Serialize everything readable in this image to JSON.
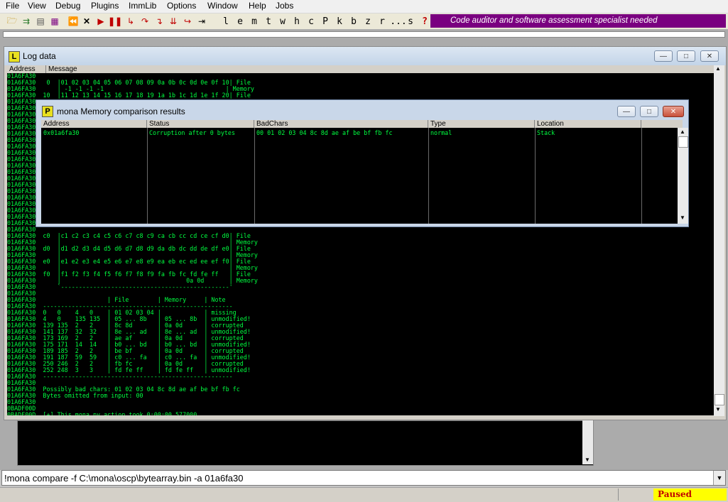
{
  "menu": [
    "File",
    "View",
    "Debug",
    "Plugins",
    "ImmLib",
    "Options",
    "Window",
    "Help",
    "Jobs"
  ],
  "toolbar": {
    "letters": [
      "l",
      "e",
      "m",
      "t",
      "w",
      "h",
      "c",
      "P",
      "k",
      "b",
      "z",
      "r",
      "...",
      "s",
      "?"
    ],
    "promo": "Code auditor and software assessment specialist needed"
  },
  "log_window": {
    "icon": "L",
    "title": "Log data",
    "col_address": "Address",
    "col_message": "Message",
    "lines": [
      "01A6FA30  ",
      "01A6FA30   0  |01 02 03 04 05 06 07 08 09 0a 0b 0c 0d 0e 0f 10| File",
      "01A6FA30      | -1 -1 -1 -1                                  | Memory",
      "01A6FA30  10  |11 12 13 14 15 16 17 18 19 1a 1b 1c 1d 1e 1f 20| File",
      "01A6FA30",
      "01A6FA30",
      "01A6FA30",
      "01A6FA30",
      "01A6FA30",
      "01A6FA30",
      "01A6FA30",
      "01A6FA30",
      "01A6FA30",
      "01A6FA30",
      "01A6FA30",
      "01A6FA30",
      "01A6FA30",
      "01A6FA30",
      "01A6FA30",
      "01A6FA30",
      "01A6FA30",
      "01A6FA30",
      "01A6FA30",
      "01A6FA30",
      "01A6FA30",
      "01A6FA30  c0  |c1 c2 c3 c4 c5 c6 c7 c8 c9 ca cb cc cd ce cf d0| File",
      "01A6FA30      |                                               | Memory",
      "01A6FA30  d0  |d1 d2 d3 d4 d5 d6 d7 d8 d9 da db dc dd de df e0| File",
      "01A6FA30      |                                               | Memory",
      "01A6FA30  e0  |e1 e2 e3 e4 e5 e6 e7 e8 e9 ea eb ec ed ee ef f0| File",
      "01A6FA30      |                                               | Memory",
      "01A6FA30  f0  |f1 f2 f3 f4 f5 f6 f7 f8 f9 fa fb fc fd fe ff   | File",
      "01A6FA30      |                                   0a 0d       | Memory",
      "01A6FA30      `-----------------------------------------------'",
      "01A6FA30",
      "01A6FA30                    | File        | Memory     | Note",
      "01A6FA30  -----------------------------------------------------",
      "01A6FA30  0   0    4   0    | 01 02 03 04 |            | missing",
      "01A6FA30  4   0    135 135  | 05 ... 8b   | 05 ... 8b  | unmodified!",
      "01A6FA30  139 135  2   2    | 8c 8d       | 0a 0d      | corrupted",
      "01A6FA30  141 137  32  32   | 8e ... ad   | 8e ... ad  | unmodified!",
      "01A6FA30  173 169  2   2    | ae af       | 0a 0d      | corrupted",
      "01A6FA30  175 171  14  14   | b0 ... bd   | b0 ... bd  | unmodified!",
      "01A6FA30  189 185  2   2    | be bf       | 0a 0d      | corrupted",
      "01A6FA30  191 187  59  59   | c0 ... fa   | c0 ... fa  | unmodified!",
      "01A6FA30  250 246  2   2    | fb fc       | 0a 0d      | corrupted",
      "01A6FA30  252 248  3   3    | fd fe ff    | fd fe ff   | unmodified!",
      "01A6FA30  -----------------------------------------------------",
      "01A6FA30",
      "01A6FA30  Possibly bad chars: 01 02 03 04 8c 8d ae af be bf fb fc",
      "01A6FA30  Bytes omitted from input: 00",
      "01A6FA30",
      "0BADF00D",
      "0BADF00D  [+] This mona.py action took 0:00:00.577000"
    ]
  },
  "mona_window": {
    "icon": "P",
    "title": "mona Memory comparison results",
    "columns": [
      "Address",
      "Status",
      "BadChars",
      "Type",
      "Location"
    ],
    "row": {
      "address": "0x01a6fa30",
      "status": "Corruption after 0 bytes",
      "badchars": "00 01 02 03 04 8c 8d ae af be bf fb fc",
      "type": "normal",
      "location": "Stack"
    }
  },
  "command": "!mona compare -f C:\\mona\\oscp\\bytearray.bin -a 01a6fa30",
  "status": "Paused",
  "colors": {
    "promo_bg": "#7a0080",
    "log_text": "#00ff40",
    "paused_bg": "#ffff00",
    "paused_text": "#c00000"
  }
}
